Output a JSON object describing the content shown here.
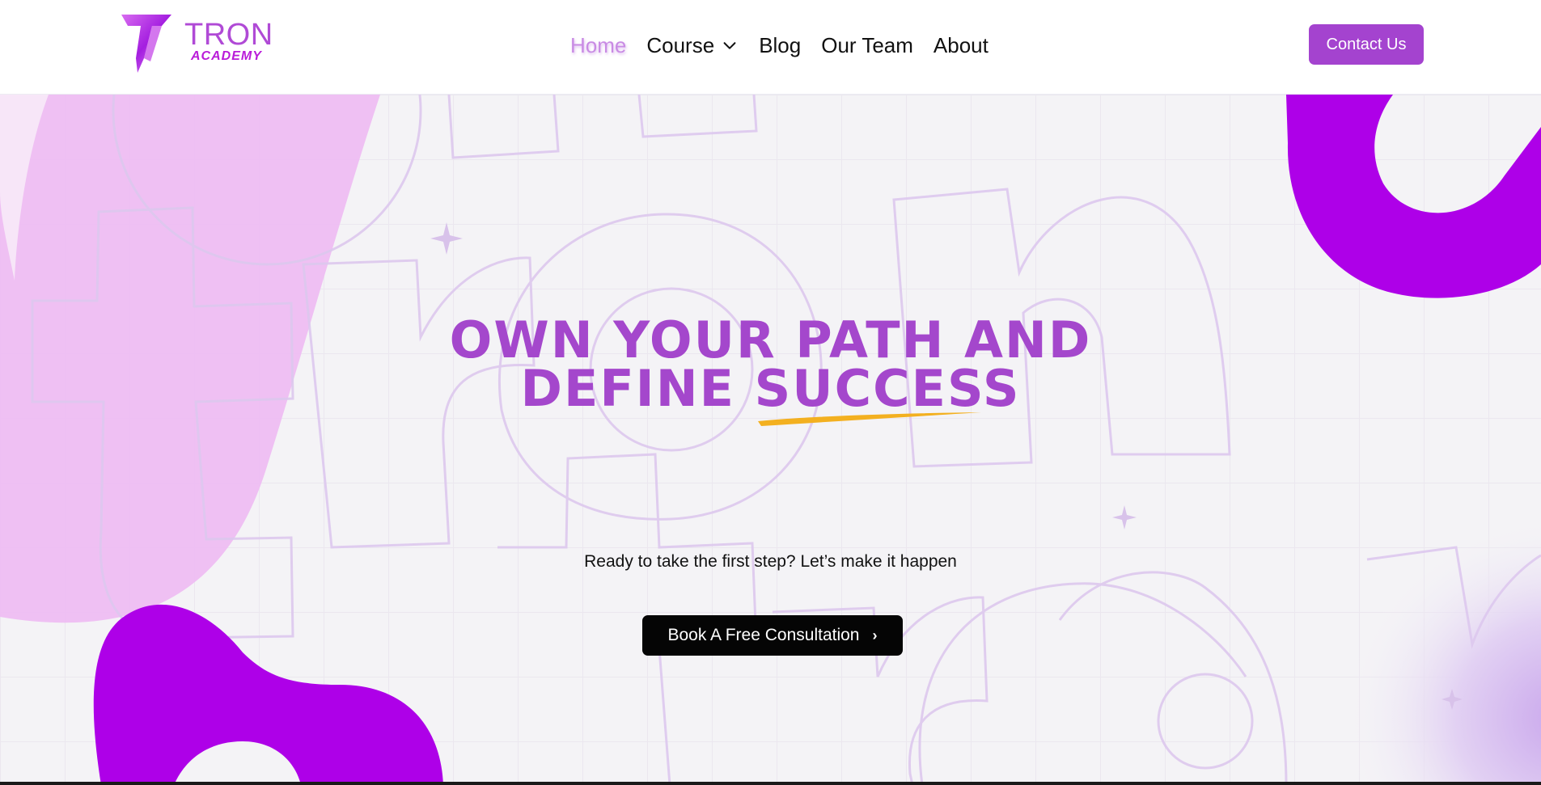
{
  "brand": {
    "name": "TRON",
    "tagline": "ACADEMY",
    "colors": {
      "primary": "#a443cf",
      "accent_purple": "#ae00e8",
      "pink_blob": "#eebdf2",
      "underline": "#f3b020"
    }
  },
  "nav": {
    "items": [
      {
        "label": "Home",
        "active": true
      },
      {
        "label": "Course",
        "has_dropdown": true,
        "icon": "chevron-down-icon"
      },
      {
        "label": "Blog"
      },
      {
        "label": "Our Team"
      },
      {
        "label": "About"
      }
    ],
    "contact_label": "Contact Us"
  },
  "hero": {
    "title_line1": "OWN YOUR PATH AND",
    "title_line2_prefix": "DEFINE ",
    "title_highlight": "SUCCESS",
    "subtitle": "Ready to take the first step? Let’s make it happen",
    "cta_label": "Book A Free Consultation",
    "cta_icon": "chevron-right-icon",
    "background_watermark": "tron"
  }
}
